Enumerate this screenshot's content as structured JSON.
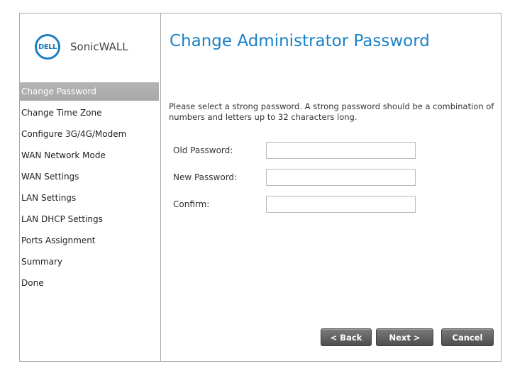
{
  "brand": {
    "logo_text": "DELL",
    "product": "SonicWALL"
  },
  "sidebar": {
    "items": [
      {
        "label": "Change Password",
        "active": true
      },
      {
        "label": "Change Time Zone"
      },
      {
        "label": "Configure 3G/4G/Modem"
      },
      {
        "label": "WAN Network Mode"
      },
      {
        "label": "WAN Settings"
      },
      {
        "label": "LAN Settings"
      },
      {
        "label": "LAN DHCP Settings"
      },
      {
        "label": "Ports Assignment"
      },
      {
        "label": "Summary"
      },
      {
        "label": "Done"
      }
    ]
  },
  "main": {
    "title": "Change Administrator Password",
    "description": "Please select a strong password. A strong password should be a combination of numbers and letters up to 32 characters long.",
    "fields": {
      "old_password": {
        "label": "Old Password:",
        "value": ""
      },
      "new_password": {
        "label": "New Password:",
        "value": ""
      },
      "confirm": {
        "label": "Confirm:",
        "value": ""
      }
    }
  },
  "buttons": {
    "back": "< Back",
    "next": "Next >",
    "cancel": "Cancel"
  },
  "colors": {
    "accent": "#1a82c8",
    "active_nav": "#b0b0b0",
    "button": "#5e5e5e"
  }
}
